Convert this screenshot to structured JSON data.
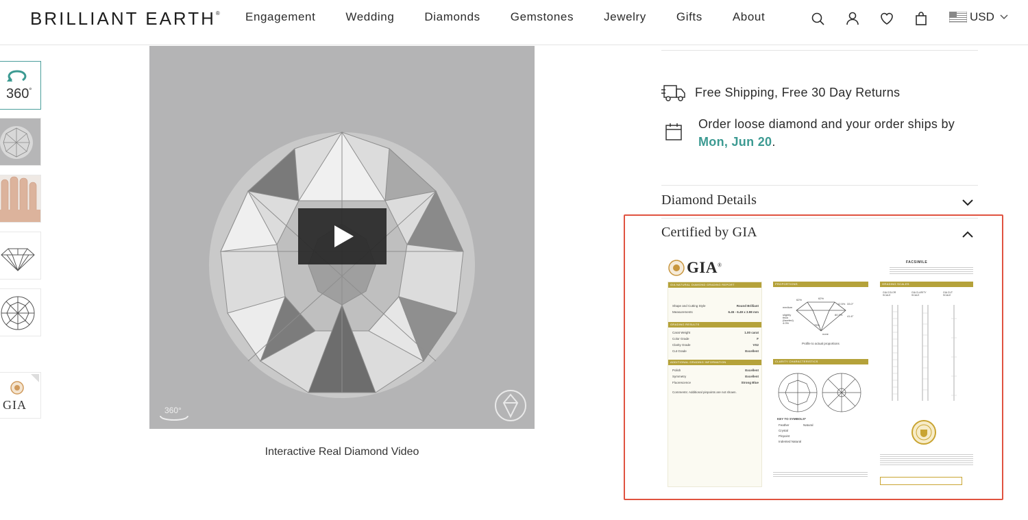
{
  "header": {
    "logo": "BRILLIANT EARTH",
    "logo_mark": "®",
    "nav": [
      "Engagement",
      "Wedding",
      "Diamonds",
      "Gemstones",
      "Jewelry",
      "Gifts",
      "About"
    ],
    "currency": "USD"
  },
  "thumbnails": {
    "t360": "360",
    "t360_sup": "°",
    "gia": "GIA"
  },
  "video": {
    "caption": "Interactive Real Diamond Video",
    "badge_360": "360°"
  },
  "info": {
    "shipping": "Free Shipping, Free 30 Day Returns",
    "order_text": "Order loose diamond and your order ships by",
    "ship_date": "Mon, Jun 20",
    "period": "."
  },
  "accordion": {
    "details_title": "Diamond Details",
    "gia_title": "Certified by GIA"
  },
  "certificate": {
    "logo": "GIA",
    "facsimile": "FACSIMILE",
    "report_header": "GIA NATURAL DIAMOND GRADING REPORT",
    "shape_label": "Shape and Cutting Style",
    "shape_value": "Round Brilliant",
    "measurements_label": "Measurements",
    "measurements_value": "6.45 - 6.49 x 3.98 mm",
    "grading_header": "GRADING RESULTS",
    "carat_label": "Carat Weight",
    "carat_value": "1.00 carat",
    "color_label": "Color Grade",
    "color_value": "F",
    "clarity_label": "Clarity Grade",
    "clarity_value": "VS2",
    "cut_label": "Cut Grade",
    "cut_value": "Excellent",
    "additional_header": "ADDITIONAL GRADING INFORMATION",
    "polish_label": "Polish",
    "polish_value": "Excellent",
    "symmetry_label": "Symmetry",
    "symmetry_value": "Excellent",
    "fluorescence_label": "Fluorescence",
    "fluorescence_value": "Strong Blue",
    "comments": "Comments: Additional pinpoints are not shown.",
    "proportions_header": "PROPORTIONS",
    "profile_caption": "Profile to actual proportions",
    "clarity_header": "CLARITY CHARACTERISTICS",
    "key_header": "KEY TO SYMBOLS*",
    "key_items": [
      "Feather",
      "Crystal",
      "Pinpoint",
      "Indented Natural",
      "Natural"
    ],
    "scales_header": "GRADING SCALES",
    "scale_heads": [
      "GIA COLOR SCALE",
      "GIA CLARITY SCALE",
      "GIA CUT SCALE"
    ]
  },
  "colors": {
    "accent": "#3c9a92",
    "highlight": "#e0523f",
    "gia_gold": "#b5a23a",
    "video_bg": "#b4b4b5"
  }
}
